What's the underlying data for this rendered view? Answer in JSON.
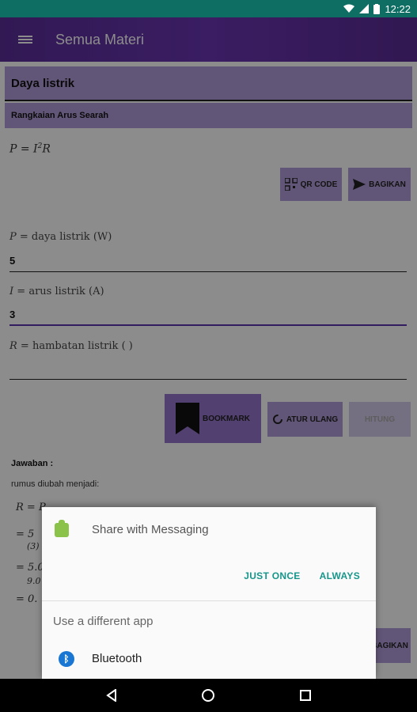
{
  "status": {
    "time": "12:22"
  },
  "appbar": {
    "title": "Semua Materi"
  },
  "topic": {
    "title": "Daya listrik",
    "subtitle": "Rangkaian Arus Searah"
  },
  "formula": {
    "lhs": "P = I",
    "exp": "2",
    "rhs": "R"
  },
  "buttons": {
    "qr": "QR CODE",
    "share": "BAGIKAN",
    "bookmark": "BOOKMARK",
    "reset": "ATUR ULANG",
    "calculate": "HITUNG",
    "share_bottom": "BAGIKAN"
  },
  "fields": [
    {
      "symbol": "P =",
      "desc": "daya listrik (W)",
      "value": "5"
    },
    {
      "symbol": "I =",
      "desc": "arus listrik (A)",
      "value": "3"
    },
    {
      "symbol": "R =",
      "desc": "hambatan listrik (  )",
      "value": ""
    }
  ],
  "answer": {
    "label": "Jawaban :",
    "note": "rumus diubah menjadi:",
    "lines": [
      "R = P",
      "= 5",
      "(3)",
      "= 5.0",
      "9.0",
      "= 0."
    ]
  },
  "dialog": {
    "title": "Share with Messaging",
    "just_once": "JUST ONCE",
    "always": "ALWAYS",
    "other": "Use a different app",
    "app_name": "Bluetooth",
    "app_icon": "bluetooth-icon"
  },
  "colors": {
    "appbar": "#6a35b3",
    "card": "#b39ddb",
    "accent": "#16968a",
    "status": "#0e6e63"
  }
}
